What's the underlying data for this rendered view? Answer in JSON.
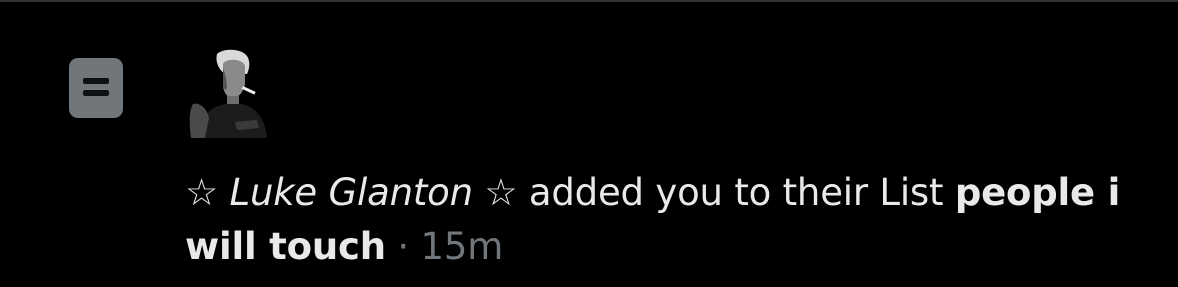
{
  "notification": {
    "type_icon": "list-icon",
    "avatar_icon": "user-avatar",
    "actor_name": "☆ Luke Glanton ☆",
    "action_text": "added you to their List",
    "list_name": "people i will touch",
    "separator": "·",
    "timestamp": "15m"
  },
  "colors": {
    "background": "#000000",
    "text_primary": "#e7e9ea",
    "text_secondary": "#71767b",
    "icon_fill": "#71767b"
  }
}
